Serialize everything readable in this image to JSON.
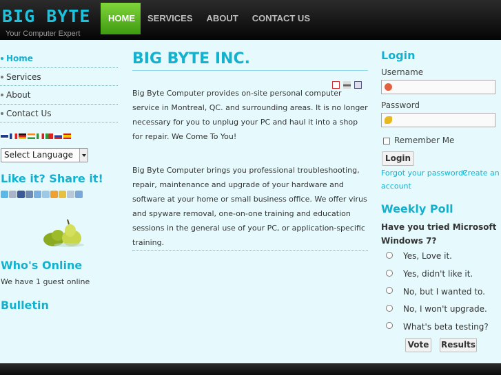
{
  "header": {
    "logo": "BIG BYTE",
    "tagline": "Your Computer Expert",
    "nav": [
      "HOME",
      "SERVICES",
      "ABOUT",
      "CONTACT US"
    ]
  },
  "sidebar": {
    "menu": [
      "Home",
      "Services",
      "About",
      "Contact Us"
    ],
    "language_select": "Select Language",
    "share_heading": "Like it? Share it!",
    "online_heading": "Who's Online",
    "online_text": "We have 1 guest online",
    "bulletin_heading": "Bulletin"
  },
  "main": {
    "title": "BIG BYTE INC.",
    "paragraph1": "Big Byte Computer provides on-site personal computer service in Montreal, QC. and surrounding areas. It is no longer necessary for you to unplug your PC and haul it into a shop for repair. We Come To You!",
    "paragraph2": "Big Byte Computer brings you professional troubleshooting, repair, maintenance and upgrade of your hardware and software at your home or small business office. We offer virus and spyware removal, one-on-one training and education sessions in the general use of your PC, or application-specific training."
  },
  "login": {
    "heading": "Login",
    "username_label": "Username",
    "password_label": "Password",
    "remember_label": "Remember Me",
    "button": "Login",
    "forgot_link": "Forgot your password?",
    "create_link_1": "Create an",
    "create_link_2": "account"
  },
  "poll": {
    "heading": "Weekly Poll",
    "question": "Have you tried Microsoft Windows 7?",
    "options": [
      "Yes, Love it.",
      "Yes, didn't like it.",
      "No, but I wanted to.",
      "No, I won't upgrade.",
      "What's beta testing?"
    ],
    "vote_button": "Vote",
    "results_button": "Results"
  },
  "colors": {
    "accent": "#14b1cf",
    "nav_active": "#5bb821",
    "background": "#e6fafd"
  }
}
